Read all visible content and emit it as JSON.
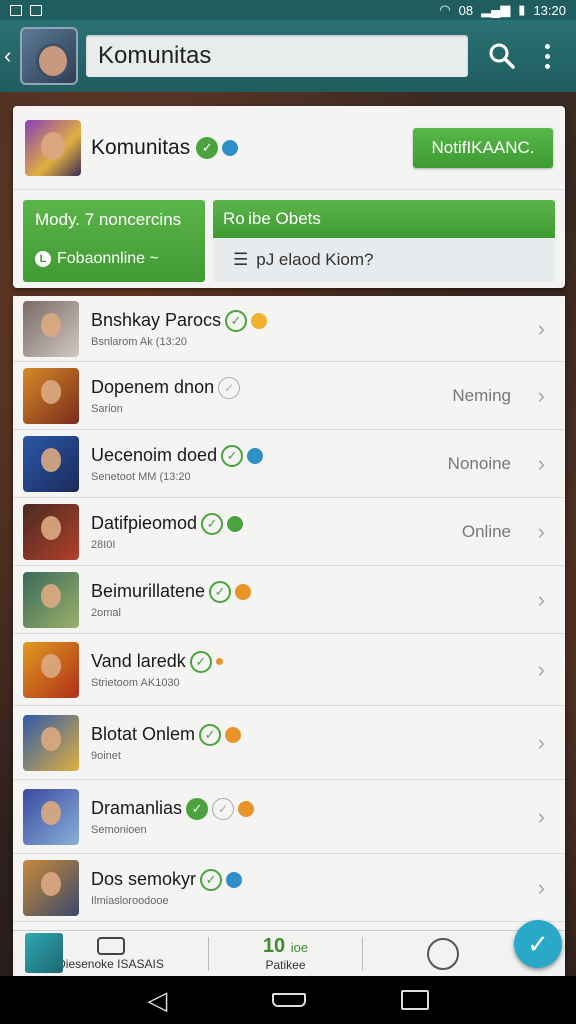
{
  "status_bar": {
    "icons_left": [
      "image-icon",
      "image-icon"
    ],
    "right_text": "08",
    "time": "13:20"
  },
  "app_bar": {
    "title": "Komunitas"
  },
  "header": {
    "name": "Komunitas",
    "notif_button": "NotifIKAANC.",
    "stat": {
      "line1": "Mody. 7 noncercins",
      "line2": "Fobaonnline ~"
    },
    "post": {
      "head": "Ro ibe Obets",
      "field": "pJ elaod Kiom?"
    }
  },
  "rows": [
    {
      "name": "Bnshkay Parocs",
      "sub": "Bsnlarom Ak (13:20",
      "status": "",
      "badge": "green",
      "dot": "yellow",
      "avatar": [
        "#7a6a66",
        "#d0c8c4"
      ]
    },
    {
      "name": "Dopenem dnon",
      "sub": "Sarion",
      "status": "Neming",
      "badge": "outline-gray",
      "dot": "",
      "avatar": [
        "#d68a28",
        "#7b2a1c"
      ]
    },
    {
      "name": "Uecenoim doed",
      "sub": "Senetoot MM (13:20",
      "status": "Nonoine",
      "badge": "green",
      "dot": "blue",
      "avatar": [
        "#2a58a8",
        "#1c2a5a"
      ]
    },
    {
      "name": "Datifpieomod",
      "sub": "28I0I",
      "status": "Online",
      "badge": "green",
      "dot": "green",
      "avatar": [
        "#4a2a22",
        "#b3402a"
      ]
    },
    {
      "name": "Beimurillatene",
      "sub": "2omal",
      "status": "",
      "badge": "green",
      "dot": "orange",
      "avatar": [
        "#3a6a5a",
        "#9ab06a"
      ]
    },
    {
      "name": "Vand laredk",
      "sub": "Strietoom AK1030",
      "status": "",
      "badge": "green",
      "dot": "small",
      "avatar": [
        "#e09a20",
        "#b0301a"
      ]
    },
    {
      "name": "Blotat Onlem",
      "sub": "9oinet",
      "status": "",
      "badge": "green",
      "dot": "orange",
      "avatar": [
        "#2e5aa8",
        "#e0b040"
      ]
    },
    {
      "name": "Dramanlias",
      "sub": "Semonioen",
      "status": "",
      "badge": "greenfill",
      "dot": "orange",
      "extra": "outline-gray",
      "avatar": [
        "#3a4aa0",
        "#8ab0d8"
      ]
    },
    {
      "name": "Dos semokyr",
      "sub": "Ilmiasloroodooe",
      "status": "",
      "badge": "green",
      "dot": "blue",
      "avatar": [
        "#c88a3a",
        "#3a4a6a"
      ]
    }
  ],
  "tabs": {
    "tab1": {
      "label": "Diesenoke ISASAIS"
    },
    "tab2": {
      "count": "10",
      "count_suffix": "ioe",
      "label": "Patikee"
    }
  },
  "colors": {
    "appbar": "#1f5d5f",
    "accent_green": "#4aa33c",
    "fab": "#29a8c9"
  }
}
